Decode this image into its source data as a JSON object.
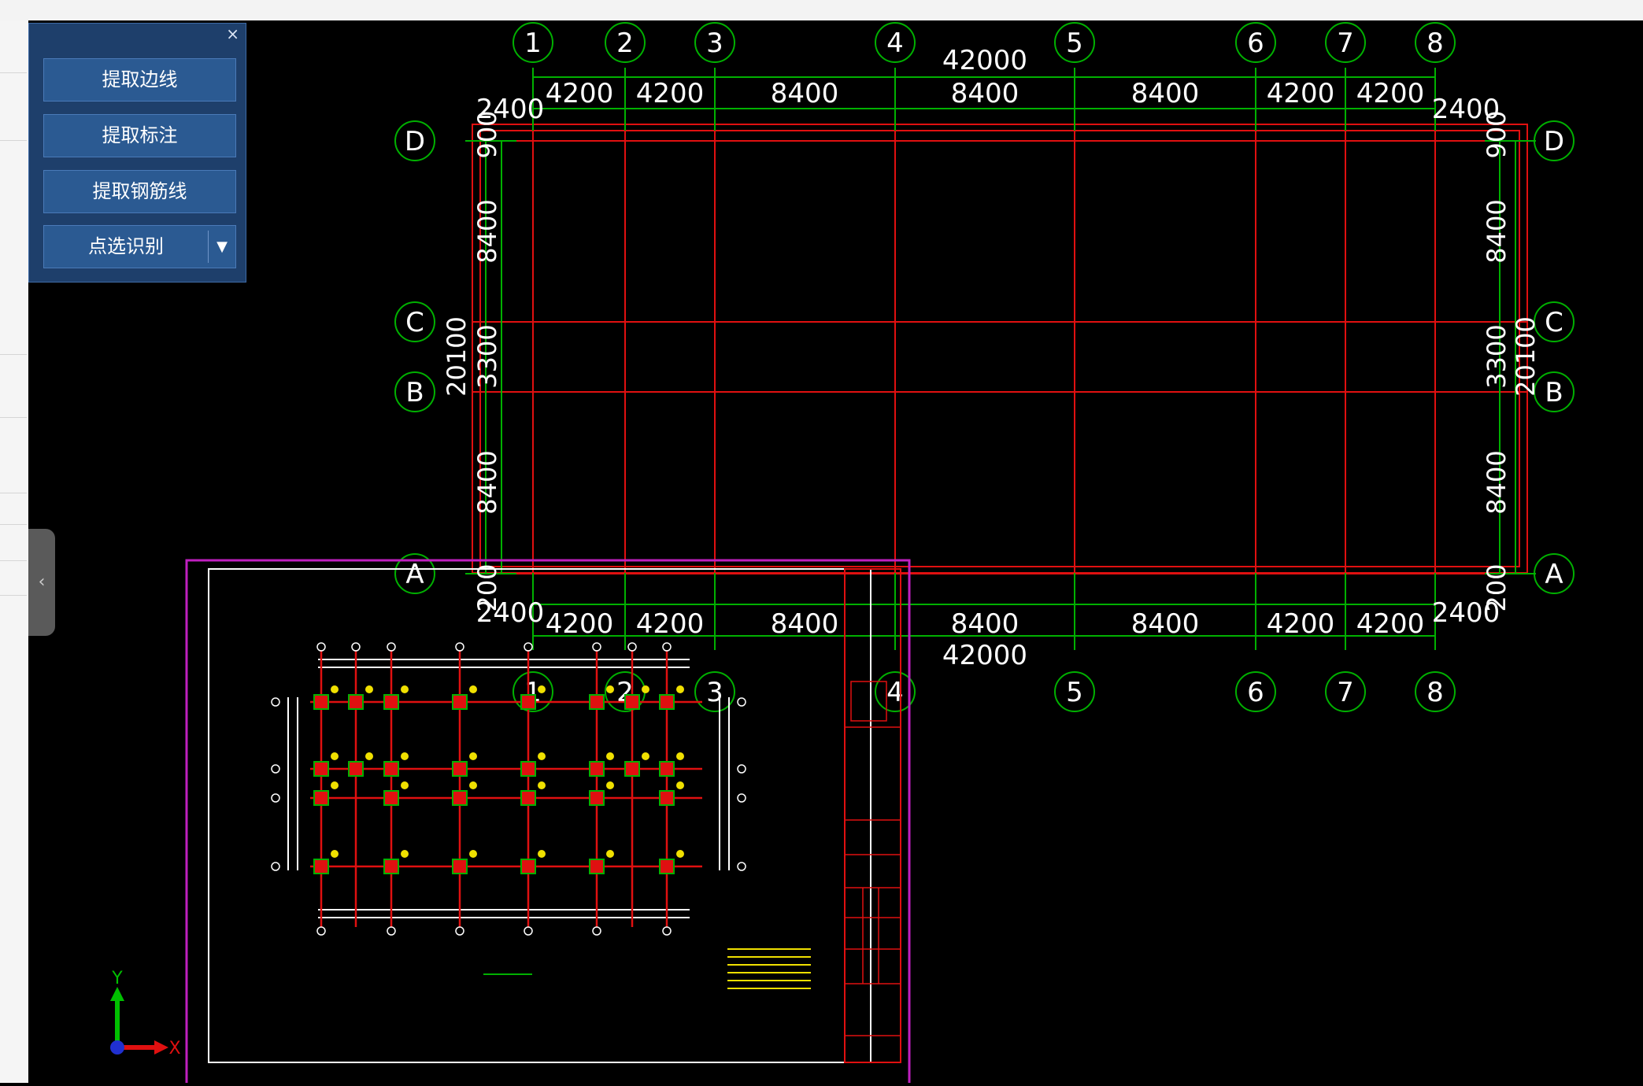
{
  "panel": {
    "close_glyph": "×",
    "buttons": [
      "提取边线",
      "提取标注",
      "提取钢筋线"
    ],
    "split_button_label": "点选识别",
    "dropdown_glyph": "▼"
  },
  "collapse_glyph": "‹",
  "drawing": {
    "overall_length": "42000",
    "overall_width": "20100",
    "bay_dims": [
      "4200",
      "4200",
      "8400",
      "8400",
      "8400",
      "4200",
      "4200"
    ],
    "end_offset": "2400",
    "span_dims": [
      "8400",
      "3300",
      "8400"
    ],
    "top_offset": "900",
    "bottom_offset": "200",
    "axis_numbers": [
      "1",
      "2",
      "3",
      "4",
      "5",
      "6",
      "7",
      "8"
    ],
    "axis_letters": [
      "D",
      "C",
      "B",
      "A"
    ]
  },
  "ucs": {
    "x_label": "X",
    "y_label": "Y"
  },
  "colors": {
    "grid_line": "#e01010",
    "dimension": "#00b000",
    "text": "#ffffff",
    "frame": "#c020c0",
    "panel_bg": "#1e3f6b",
    "button_bg": "#2b5a92"
  }
}
